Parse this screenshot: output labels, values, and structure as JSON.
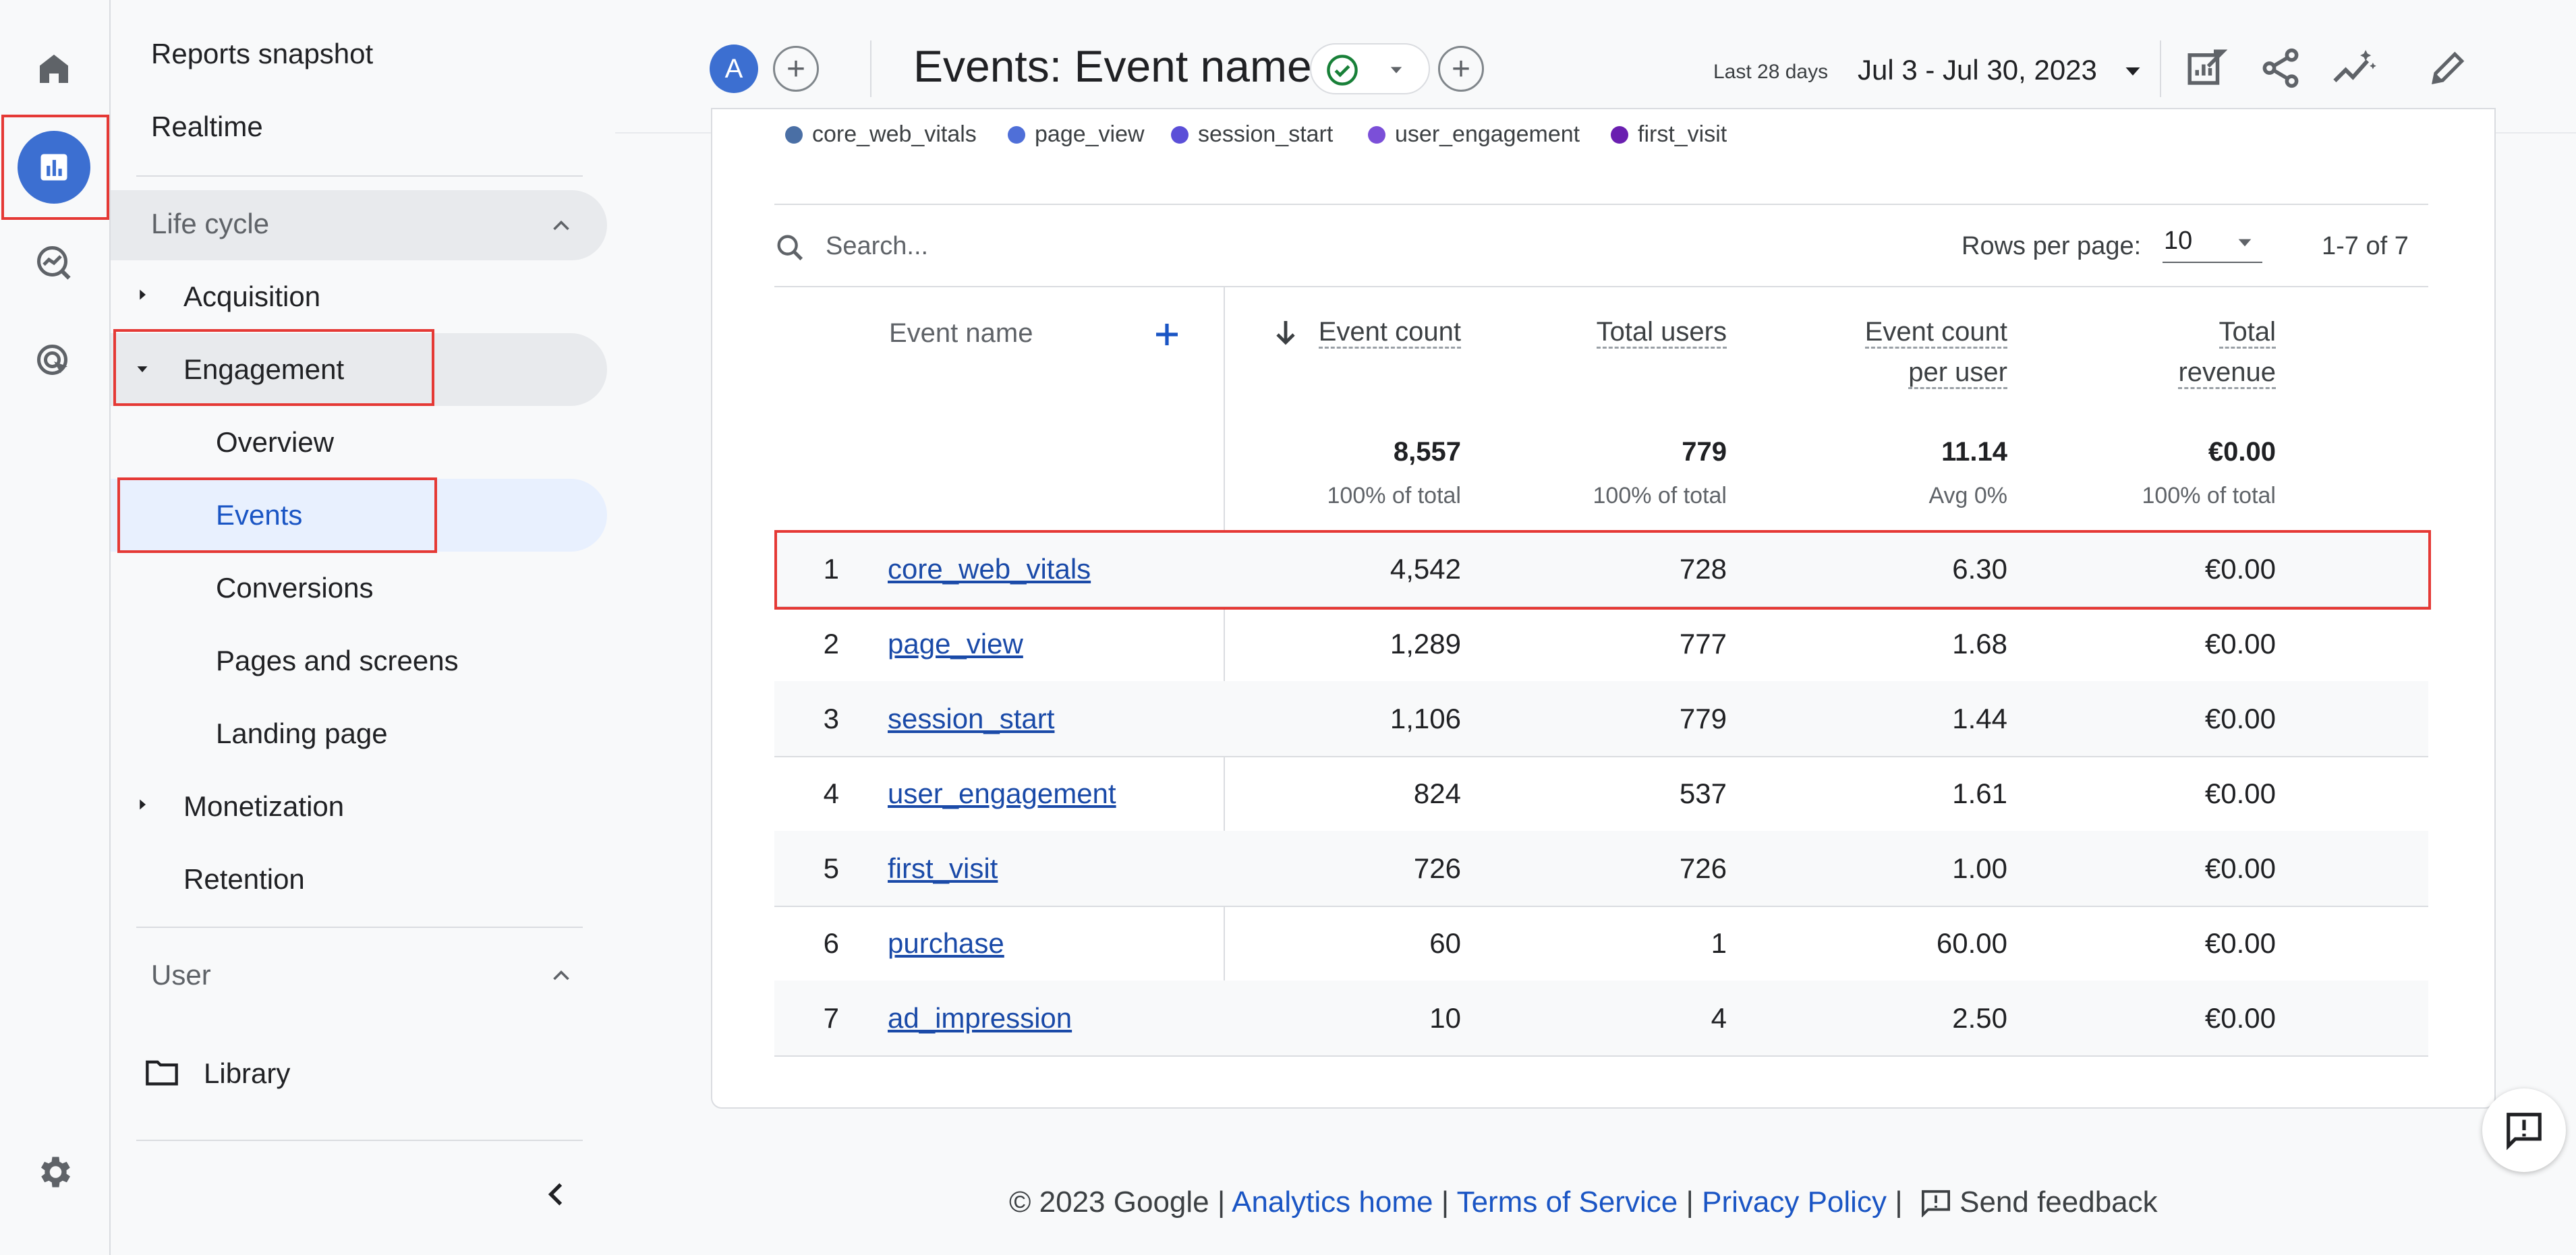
{
  "nav": {
    "reports_snapshot": "Reports snapshot",
    "realtime": "Realtime",
    "lifecycle": "Life cycle",
    "acquisition": "Acquisition",
    "engagement": "Engagement",
    "overview": "Overview",
    "events": "Events",
    "conversions": "Conversions",
    "pages_and_screens": "Pages and screens",
    "landing_page": "Landing page",
    "monetization": "Monetization",
    "retention": "Retention",
    "user": "User",
    "library": "Library"
  },
  "topbar": {
    "avatar_letter": "A",
    "title": "Events: Event name",
    "date_label": "Last 28 days",
    "date_range": "Jul 3 - Jul 30, 2023"
  },
  "legend": [
    "core_web_vitals",
    "page_view",
    "session_start",
    "user_engagement",
    "first_visit"
  ],
  "legend_colors": [
    "#4a6fa5",
    "#4f6fd8",
    "#5b4fd8",
    "#7b4fd8",
    "#6a1fb0"
  ],
  "table": {
    "search_placeholder": "Search...",
    "rows_per_page_label": "Rows per page:",
    "rows_per_page_value": "10",
    "pagination": "1-7 of 7",
    "headers": {
      "event_name": "Event name",
      "event_count": "Event count",
      "total_users": "Total users",
      "per_user_1": "Event count",
      "per_user_2": "per user",
      "revenue_1": "Total",
      "revenue_2": "revenue"
    },
    "totals": {
      "event_count": "8,557",
      "event_count_sub": "100% of total",
      "total_users": "779",
      "total_users_sub": "100% of total",
      "per_user": "11.14",
      "per_user_sub": "Avg 0%",
      "revenue": "€0.00",
      "revenue_sub": "100% of total"
    },
    "rows": [
      {
        "rank": "1",
        "name": "core_web_vitals",
        "count": "4,542",
        "users": "728",
        "per_user": "6.30",
        "revenue": "€0.00"
      },
      {
        "rank": "2",
        "name": "page_view",
        "count": "1,289",
        "users": "777",
        "per_user": "1.68",
        "revenue": "€0.00"
      },
      {
        "rank": "3",
        "name": "session_start",
        "count": "1,106",
        "users": "779",
        "per_user": "1.44",
        "revenue": "€0.00"
      },
      {
        "rank": "4",
        "name": "user_engagement",
        "count": "824",
        "users": "537",
        "per_user": "1.61",
        "revenue": "€0.00"
      },
      {
        "rank": "5",
        "name": "first_visit",
        "count": "726",
        "users": "726",
        "per_user": "1.00",
        "revenue": "€0.00"
      },
      {
        "rank": "6",
        "name": "purchase",
        "count": "60",
        "users": "1",
        "per_user": "60.00",
        "revenue": "€0.00"
      },
      {
        "rank": "7",
        "name": "ad_impression",
        "count": "10",
        "users": "4",
        "per_user": "2.50",
        "revenue": "€0.00"
      }
    ]
  },
  "footer": {
    "copyright": "© 2023 Google |",
    "analytics_home": "Analytics home",
    "sep1": "|",
    "terms": "Terms of Service",
    "sep2": "|",
    "privacy": "Privacy Policy",
    "sep3": "|",
    "send_feedback": "Send feedback"
  }
}
